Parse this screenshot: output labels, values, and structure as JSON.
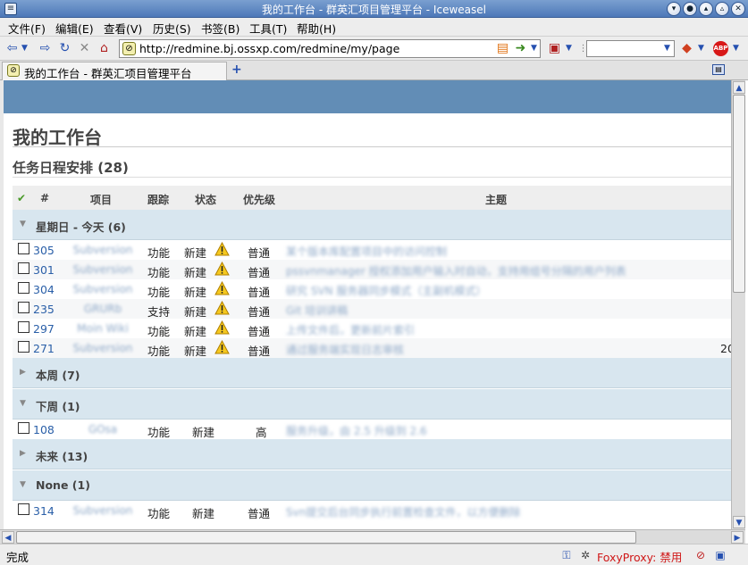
{
  "window": {
    "title": "我的工作台 - 群英汇项目管理平台 - Iceweasel"
  },
  "menu": [
    "文件(F)",
    "编辑(E)",
    "查看(V)",
    "历史(S)",
    "书签(B)",
    "工具(T)",
    "帮助(H)"
  ],
  "nav": {
    "url": "http://redmine.bj.ossxp.com/redmine/my/page",
    "search_placeholder": ""
  },
  "tab": {
    "label": "我的工作台 - 群英汇项目管理平台"
  },
  "page": {
    "title": "我的工作台",
    "section_title": "任务日程安排 (28)"
  },
  "table": {
    "headers": {
      "check": "✔",
      "id": "#",
      "project": "项目",
      "tracker": "跟踪",
      "status": "状态",
      "priority": "优先级",
      "subject": "主题"
    }
  },
  "groups": [
    {
      "name": "星期日 - 今天 (6)",
      "expanded": true
    },
    {
      "name": "本周 (7)",
      "expanded": false
    },
    {
      "name": "下周 (1)",
      "expanded": true
    },
    {
      "name": "未来 (13)",
      "expanded": false
    },
    {
      "name": "None (1)",
      "expanded": true
    }
  ],
  "rows": [
    {
      "id": "305",
      "project": "Subversion",
      "tracker": "功能",
      "status": "新建",
      "warn": true,
      "priority": "普通",
      "subject": "某个版本库配置项目中的访问控制",
      "extra": ""
    },
    {
      "id": "301",
      "project": "Subversion",
      "tracker": "功能",
      "status": "新建",
      "warn": true,
      "priority": "普通",
      "subject": "pssvnmanager 授权添加用户输入时自动，支持用组号分隔的用户列表",
      "extra": ""
    },
    {
      "id": "304",
      "project": "Subversion",
      "tracker": "功能",
      "status": "新建",
      "warn": true,
      "priority": "普通",
      "subject": "研究 SVN 服务器同步模式（主副机模式）",
      "extra": ""
    },
    {
      "id": "235",
      "project": "GRURb",
      "tracker": "支持",
      "status": "新建",
      "warn": true,
      "priority": "普通",
      "subject": "Git 培训讲稿",
      "extra": ""
    },
    {
      "id": "297",
      "project": "Moin Wiki",
      "tracker": "功能",
      "status": "新建",
      "warn": true,
      "priority": "普通",
      "subject": "上传文件后，更新前片索引",
      "extra": ""
    },
    {
      "id": "271",
      "project": "Subversion",
      "tracker": "功能",
      "status": "新建",
      "warn": true,
      "priority": "普通",
      "subject": "通过服务端实现日志审核",
      "extra": "20"
    },
    {
      "id": "108",
      "project": "GOsa",
      "tracker": "功能",
      "status": "新建",
      "warn": false,
      "priority": "高",
      "subject": "服务升级，由 2.5 升级到 2.6",
      "extra": ""
    },
    {
      "id": "314",
      "project": "Subversion",
      "tracker": "功能",
      "status": "新建",
      "warn": false,
      "priority": "普通",
      "subject": "Svn提交后台同步执行前置检查文件，以方便删除",
      "extra": ""
    }
  ],
  "status": {
    "text": "完成",
    "foxyproxy": "FoxyProxy: 禁用"
  },
  "colors": {
    "banner": "#628db6",
    "link": "#2a5fa8",
    "group_bg": "#d8e6ef",
    "titlebar": "#5a84c0",
    "foxyproxy": "#d01818"
  }
}
